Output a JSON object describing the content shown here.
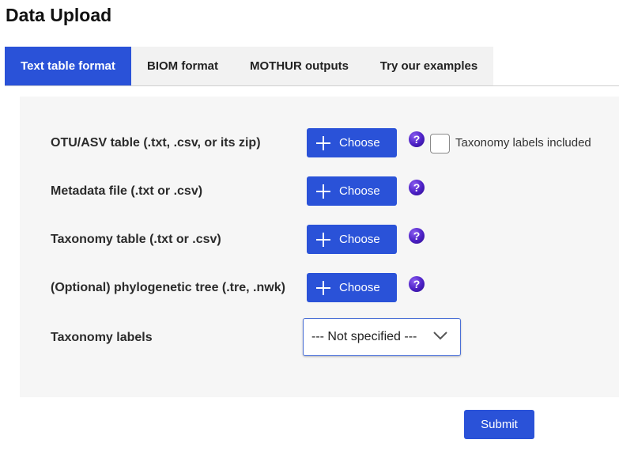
{
  "page": {
    "title": "Data Upload"
  },
  "tabs": [
    {
      "label": "Text table format",
      "active": true
    },
    {
      "label": "BIOM format",
      "active": false
    },
    {
      "label": "MOTHUR outputs",
      "active": false
    },
    {
      "label": "Try our examples",
      "active": false
    }
  ],
  "form": {
    "rows": [
      {
        "label": "OTU/ASV table (.txt, .csv, or its zip)",
        "button": "Choose",
        "help": "?"
      },
      {
        "label": "Metadata file (.txt or .csv)",
        "button": "Choose",
        "help": "?"
      },
      {
        "label": "Taxonomy table (.txt or .csv)",
        "button": "Choose",
        "help": "?"
      },
      {
        "label": "(Optional) phylogenetic tree (.tre, .nwk)",
        "button": "Choose",
        "help": "?"
      }
    ],
    "taxonomy_included_checkbox": {
      "label": "Taxonomy labels included",
      "checked": false
    },
    "taxonomy_labels": {
      "label": "Taxonomy labels",
      "selected": "--- Not specified ---"
    },
    "submit_label": "Submit"
  },
  "icons": {
    "add": "plus-icon",
    "help": "help-icon",
    "dropdown": "chevron-down-icon"
  },
  "colors": {
    "primary": "#2a52d8",
    "tab_inactive_bg": "#f2f2f2",
    "panel_bg": "#f6f6f6",
    "help_icon": "#4b1fc4"
  }
}
